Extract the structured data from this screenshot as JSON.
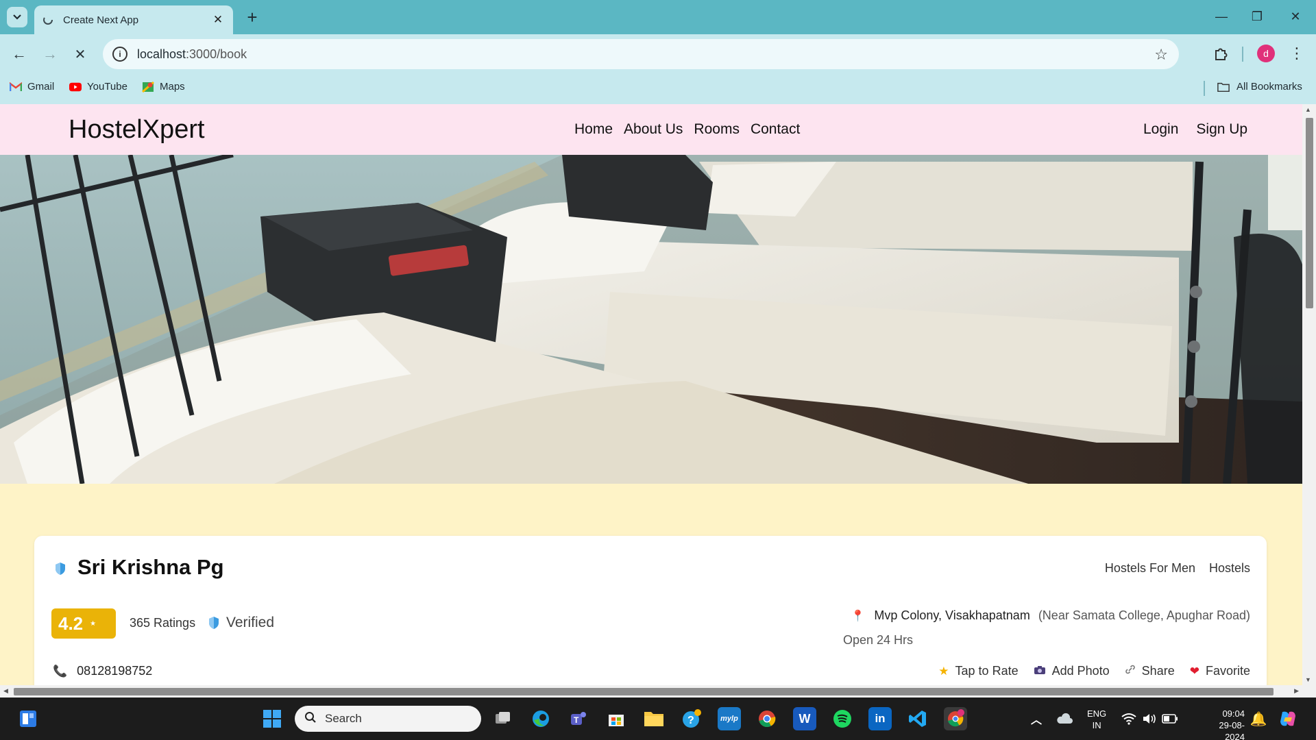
{
  "browser": {
    "tab_title": "Create Next App",
    "url_host": "localhost",
    "url_path": ":3000/book",
    "bookmarks": [
      {
        "label": "Gmail",
        "icon": "gmail-icon"
      },
      {
        "label": "YouTube",
        "icon": "youtube-icon"
      },
      {
        "label": "Maps",
        "icon": "maps-icon"
      }
    ],
    "all_bookmarks": "All Bookmarks",
    "profile_initial": "d"
  },
  "site": {
    "brand": "HostelXpert",
    "nav": [
      "Home",
      "About Us",
      "Rooms",
      "Contact"
    ],
    "auth": [
      "Login",
      "Sign Up"
    ]
  },
  "listing": {
    "name": "Sri Krishna Pg",
    "categories": [
      "Hostels For Men",
      "Hostels"
    ],
    "rating": "4.2",
    "ratings_count": "365 Ratings",
    "verified": "Verified",
    "location": "Mvp Colony, Visakhapatnam",
    "location_near": "(Near Samata College, Apughar Road)",
    "hours": "Open 24 Hrs",
    "phone": "08128198752",
    "actions": [
      {
        "label": "Tap to Rate",
        "icon": "star-icon"
      },
      {
        "label": "Add Photo",
        "icon": "camera-icon"
      },
      {
        "label": "Share",
        "icon": "share-icon"
      },
      {
        "label": "Favorite",
        "icon": "heart-icon"
      }
    ]
  },
  "taskbar": {
    "search_placeholder": "Search",
    "lang_line1": "ENG",
    "lang_line2": "IN",
    "time": "09:04",
    "date": "29-08-2024"
  },
  "colors": {
    "tabstrip": "#5bb7c3",
    "toolbar": "#c6e9ee",
    "site_nav": "#fde4f0",
    "page_bg": "#fef3c7",
    "rating_badge": "#eab308"
  }
}
